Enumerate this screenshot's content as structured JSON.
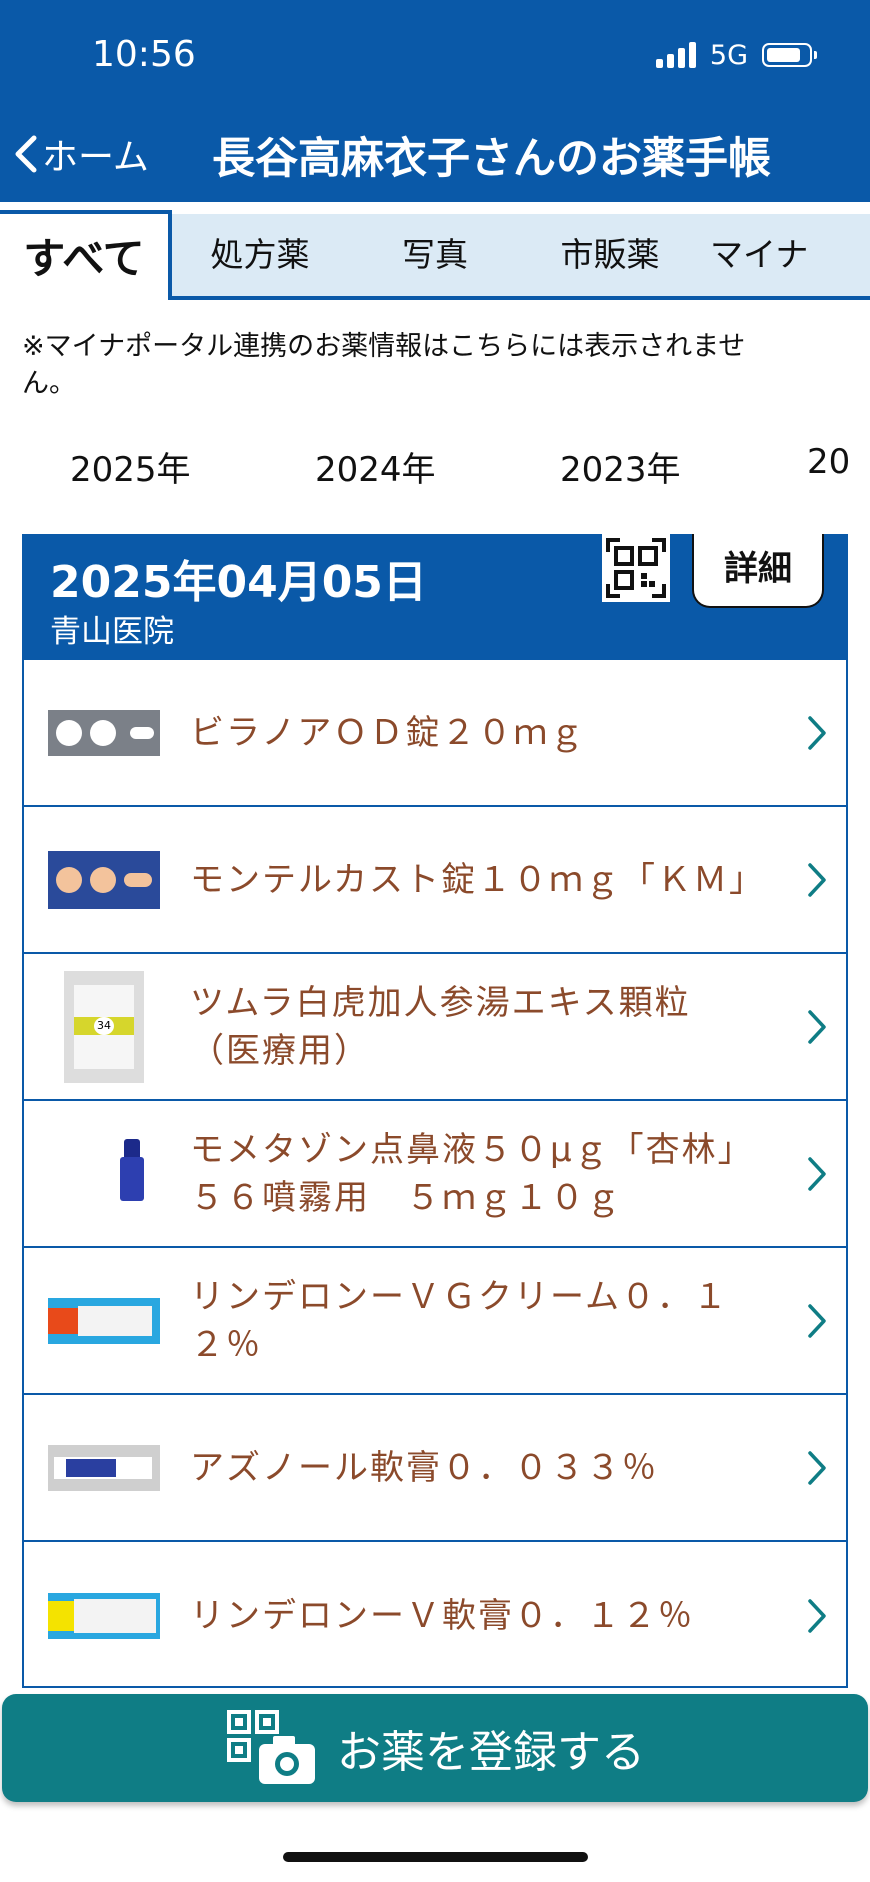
{
  "status_bar": {
    "time": "10:56",
    "network": "5G"
  },
  "header": {
    "back_label": "ホーム",
    "title": "長谷高麻衣子さんのお薬手帳"
  },
  "tabs": [
    {
      "label": "すべて",
      "active": true
    },
    {
      "label": "処方薬",
      "active": false
    },
    {
      "label": "写真",
      "active": false
    },
    {
      "label": "市販薬",
      "active": false
    },
    {
      "label": "マイナ",
      "active": false
    }
  ],
  "notice": "※マイナポータル連携のお薬情報はこちらには表示されません。",
  "years": [
    "2025年",
    "2024年",
    "2023年",
    "20"
  ],
  "record": {
    "date": "2025年04月05日",
    "clinic": "青山医院",
    "detail_label": "詳細",
    "medicines": [
      {
        "name": "ビラノアＯＤ錠２０ｍｇ",
        "image": "white-tablets"
      },
      {
        "name": "モンテルカスト錠１０ｍｇ「ＫＭ」",
        "image": "orange-tablets"
      },
      {
        "name": "ツムラ白虎加人参湯エキス顆粒（医療用）",
        "image": "granule-pack"
      },
      {
        "name": "モメタゾン点鼻液５０μｇ「杏林」５６噴霧用　５ｍｇ１０ｇ",
        "image": "nasal-spray"
      },
      {
        "name": "リンデロンーＶＧクリーム０．１２％",
        "image": "cream-tube"
      },
      {
        "name": "アズノール軟膏０．０３３％",
        "image": "ointment-tube"
      },
      {
        "name": "リンデロンーＶ軟膏０．１２％",
        "image": "ointment-tube"
      }
    ]
  },
  "cta": {
    "label": "お薬を登録する"
  },
  "colors": {
    "primary": "#0a59a8",
    "tab_bg": "#dbeaf5",
    "med_text": "#8b4a2b",
    "cta": "#0f7d85",
    "chevron": "#0f7d85"
  }
}
